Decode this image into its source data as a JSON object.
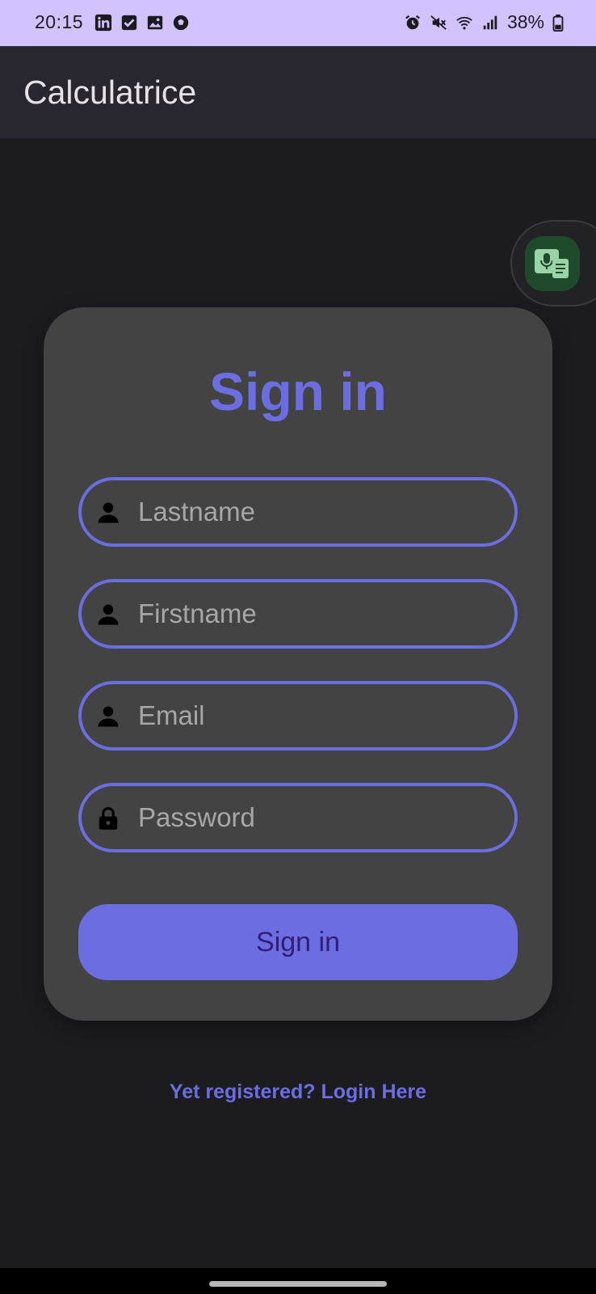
{
  "status_bar": {
    "time": "20:15",
    "battery": "38%",
    "left_icons": [
      "linkedin-icon",
      "check-icon",
      "image-icon",
      "soccer-icon"
    ],
    "right_icons": [
      "alarm-icon",
      "mute-icon",
      "wifi-icon",
      "signal-icon",
      "battery-icon"
    ]
  },
  "app_bar": {
    "title": "Calculatrice"
  },
  "form": {
    "title": "Sign in",
    "fields": [
      {
        "placeholder": "Lastname",
        "icon": "person-icon"
      },
      {
        "placeholder": "Firstname",
        "icon": "person-icon"
      },
      {
        "placeholder": "Email",
        "icon": "person-icon"
      },
      {
        "placeholder": "Password",
        "icon": "lock-icon"
      }
    ],
    "submit_label": "Sign in"
  },
  "footer": {
    "login_link": "Yet registered? Login Here"
  },
  "colors": {
    "accent": "#6b6de0",
    "background": "#1c1b20",
    "card": "#434343",
    "status_bar": "#d2c2fd",
    "app_bar": "#28262e"
  }
}
